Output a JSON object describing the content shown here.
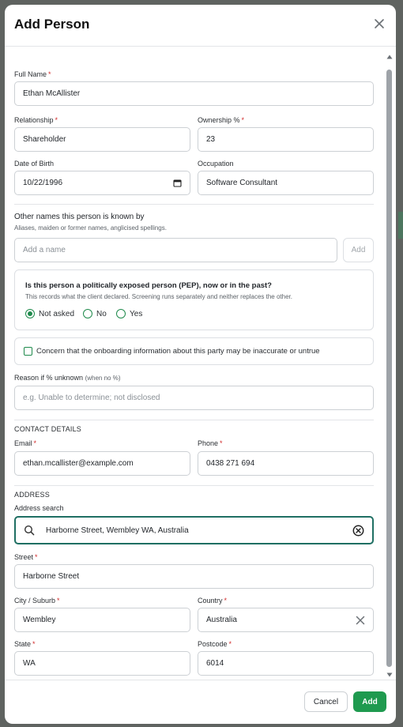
{
  "modal": {
    "title": "Add Person"
  },
  "fields": {
    "full_name": {
      "label": "Full Name",
      "value": "Ethan McAllister"
    },
    "relationship": {
      "label": "Relationship",
      "value": "Shareholder"
    },
    "ownership": {
      "label": "Ownership %",
      "value": "23"
    },
    "dob": {
      "label": "Date of Birth",
      "value": "10/22/1996"
    },
    "occupation": {
      "label": "Occupation",
      "value": "Software Consultant"
    }
  },
  "aliases": {
    "title": "Other names this person is known by",
    "hint": "Aliases, maiden or former names, anglicised spellings.",
    "placeholder": "Add a name",
    "add_label": "Add"
  },
  "pep": {
    "question": "Is this person a politically exposed person (PEP), now or in the past?",
    "hint": "This records what the client declared. Screening runs separately and neither replaces the other.",
    "options": [
      "Not asked",
      "No",
      "Yes"
    ],
    "selected": "Not asked"
  },
  "concern": {
    "label": "Concern that the onboarding information about this party may be inaccurate or untrue",
    "checked": false
  },
  "reason": {
    "label": "Reason if % unknown",
    "label_suffix": "(when no %)",
    "placeholder": "e.g. Unable to determine; not disclosed"
  },
  "contact": {
    "heading": "CONTACT DETAILS",
    "email": {
      "label": "Email",
      "value": "ethan.mcallister@example.com"
    },
    "phone": {
      "label": "Phone",
      "value": "0438 271 694"
    }
  },
  "address": {
    "heading": "ADDRESS",
    "search_label": "Address search",
    "search_value": "Harborne Street, Wembley WA, Australia",
    "street": {
      "label": "Street",
      "value": "Harborne Street"
    },
    "city": {
      "label": "City / Suburb",
      "value": "Wembley"
    },
    "country": {
      "label": "Country",
      "value": "Australia"
    },
    "state": {
      "label": "State",
      "value": "WA"
    },
    "postcode": {
      "label": "Postcode",
      "value": "6014"
    }
  },
  "footer": {
    "cancel_label": "Cancel",
    "add_label": "Add"
  },
  "colors": {
    "accent": "#1f9a4f",
    "focus": "#1f6f63",
    "required": "#d12b2b"
  },
  "icons": [
    "close-icon",
    "calendar-icon",
    "search-icon",
    "clear-circle-icon",
    "clear-x-icon",
    "scroll-up-icon",
    "scroll-down-icon"
  ]
}
